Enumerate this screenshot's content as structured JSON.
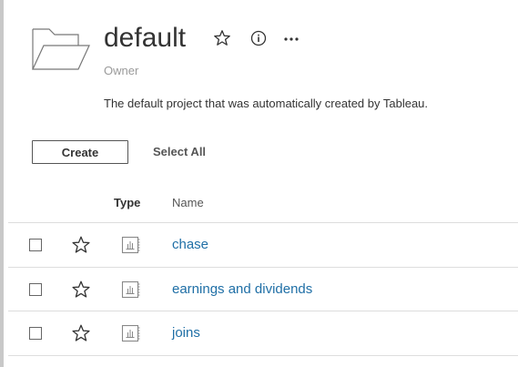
{
  "project": {
    "title": "default",
    "owner_label": "Owner",
    "description": "The default project that was automatically created by Tableau."
  },
  "header_icons": {
    "favorite": "star-icon",
    "info": "info-icon",
    "more": "more-horizontal-icon"
  },
  "toolbar": {
    "create_label": "Create",
    "select_all_label": "Select All"
  },
  "table": {
    "columns": [
      "Type",
      "Name"
    ],
    "rows": [
      {
        "name": "chase",
        "type_icon": "workbook-icon"
      },
      {
        "name": "earnings and dividends",
        "type_icon": "workbook-icon"
      },
      {
        "name": "joins",
        "type_icon": "workbook-icon"
      }
    ]
  },
  "colors": {
    "link": "#1f6fa6",
    "text": "#333333",
    "muted": "#9a9a9a",
    "divider": "#dddddd"
  }
}
